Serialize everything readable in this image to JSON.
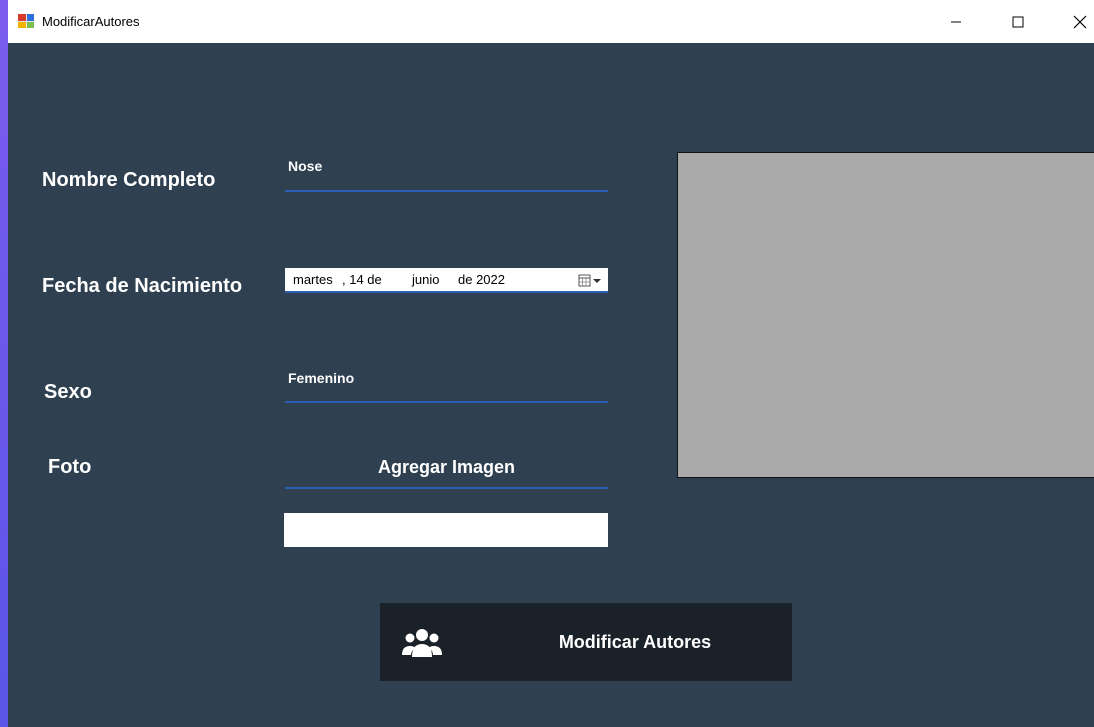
{
  "window": {
    "title": "ModificarAutores",
    "controls": {
      "minimize": "—",
      "maximize": "☐",
      "close": "✕"
    }
  },
  "form": {
    "nombre": {
      "label": "Nombre Completo",
      "value": "Nose"
    },
    "fecha": {
      "label": "Fecha de Nacimiento",
      "weekday": "martes",
      "day": ", 14 de",
      "month": "junio",
      "year": "de 2022",
      "dropdown_icon": "calendar-dropdown-icon"
    },
    "sexo": {
      "label": "Sexo",
      "value": "Femenino"
    },
    "foto": {
      "label": "Foto",
      "button_label": "Agregar Imagen",
      "path_value": ""
    }
  },
  "action": {
    "label": "Modificar Autores",
    "icon": "users-icon"
  },
  "colors": {
    "background": "#2f4050",
    "accent_underline": "#2b5fb6",
    "button_bg": "#1b2129",
    "picture_bg": "#aaaaaa"
  }
}
